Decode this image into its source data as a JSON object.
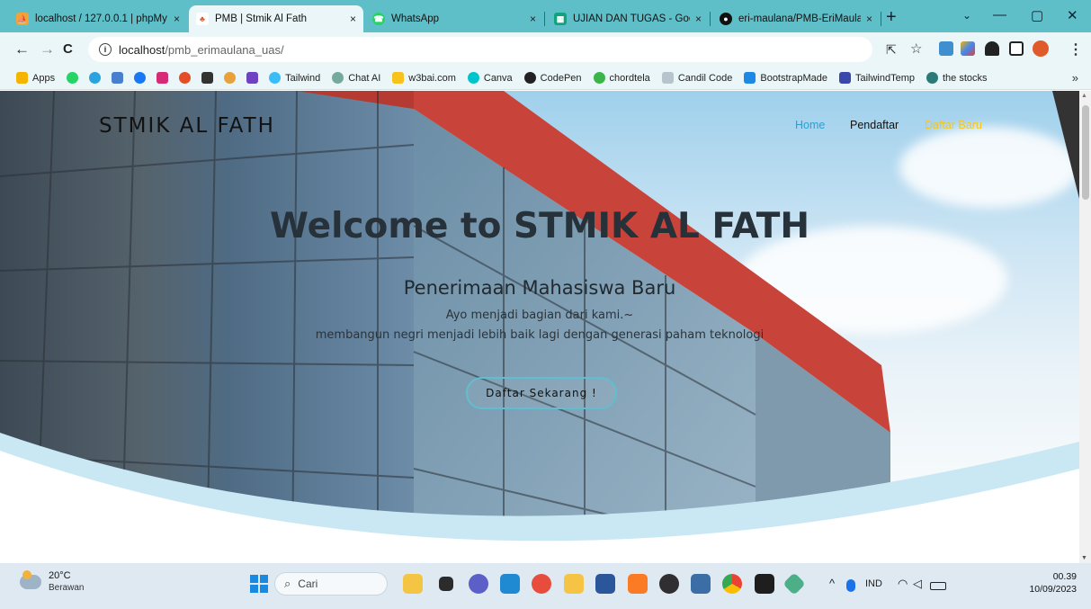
{
  "tabs": [
    {
      "title": "localhost / 127.0.0.1 | phpMy",
      "close": "×",
      "color": "#f0a33a",
      "glyph": "⛵"
    },
    {
      "title": "PMB | Stmik Al Fath",
      "close": "×",
      "color": "#ffffff",
      "glyph": "♣"
    },
    {
      "title": "WhatsApp",
      "close": "×",
      "color": "#25d366",
      "glyph": "☎"
    },
    {
      "title": "UJIAN DAN TUGAS - Google",
      "close": "×",
      "color": "#10a37f",
      "glyph": "▦"
    },
    {
      "title": "eri-maulana/PMB-EriMaulan",
      "close": "×",
      "color": "#111111",
      "glyph": "●"
    }
  ],
  "browser": {
    "new_tab": "+",
    "back": "←",
    "forward": "→",
    "reload": "C",
    "url_host": "localhost",
    "url_path": "/pmb_erimaulana_uas/",
    "info": "i",
    "share": "⇱",
    "star": "☆",
    "minimize": "—",
    "maximize": "▢",
    "close": "✕",
    "tablist": "⌄",
    "menu": "⋮"
  },
  "bookmarks": [
    {
      "label": "Apps",
      "color": "#f4b400"
    },
    {
      "label": "",
      "color": "#25d366"
    },
    {
      "label": "",
      "color": "#2aa3e0"
    },
    {
      "label": "",
      "color": "#4a7fd0"
    },
    {
      "label": "",
      "color": "#1877f2"
    },
    {
      "label": "",
      "color": "#d62976"
    },
    {
      "label": "",
      "color": "#e44d26"
    },
    {
      "label": "",
      "color": "#333333"
    },
    {
      "label": "",
      "color": "#e9a23b"
    },
    {
      "label": "",
      "color": "#6f42c1"
    },
    {
      "label": "Tailwind",
      "color": "#38bdf8"
    },
    {
      "label": "Chat AI",
      "color": "#74aa9c"
    },
    {
      "label": "w3bai.com",
      "color": "#f7c21b"
    },
    {
      "label": "Canva",
      "color": "#00c4cc"
    },
    {
      "label": "CodePen",
      "color": "#222222"
    },
    {
      "label": "chordtela",
      "color": "#3bb54a"
    },
    {
      "label": "Candil Code",
      "color": "#b8c4cc"
    },
    {
      "label": "BootstrapMade",
      "color": "#1e88e5"
    },
    {
      "label": "TailwindTemp",
      "color": "#3949ab"
    },
    {
      "label": "the stocks",
      "color": "#2b7a78"
    }
  ],
  "bookmarks_more": "»",
  "site": {
    "brand": "STMIK AL FATH",
    "nav": [
      {
        "label": "Home",
        "color": "#2a9fd6"
      },
      {
        "label": "Pendaftar",
        "color": "#111111"
      },
      {
        "label": "Daftar Baru",
        "color": "#f3c623"
      }
    ],
    "heading": "Welcome to STMIK AL FATH",
    "subheading": "Penerimaan Mahasiswa Baru",
    "tagline1": "Ayo menjadi bagian dari kami.~",
    "tagline2": "membangun negri menjadi lebih baik lagi dengan generasi paham teknologi",
    "cta": "Daftar Sekarang !",
    "accent": "#5fbfd0"
  },
  "taskbar": {
    "temp": "20°C",
    "weather": "Berawan",
    "search_placeholder": "Cari",
    "search_icon": "⌕",
    "tray_chevron": "^",
    "lang": "IND",
    "time": "00.39",
    "date": "10/09/2023",
    "apps": [
      {
        "name": "file-explorer-icon",
        "color": "#f4c542"
      },
      {
        "name": "task-view-icon",
        "color": "#2b2b2b"
      },
      {
        "name": "chat-icon",
        "color": "#5b5fc7"
      },
      {
        "name": "vscode-icon",
        "color": "#1f8ad2"
      },
      {
        "name": "chrome-icon",
        "color": "#e74c3c"
      },
      {
        "name": "folder-icon",
        "color": "#f6c445"
      },
      {
        "name": "word-icon",
        "color": "#2b579a"
      },
      {
        "name": "xampp-icon",
        "color": "#fb7a24"
      },
      {
        "name": "obs-icon",
        "color": "#302e31"
      },
      {
        "name": "virtualbox-icon",
        "color": "#3a6ea5"
      },
      {
        "name": "chrome-active-icon",
        "color": "#34a853"
      },
      {
        "name": "terminal-icon",
        "color": "#1e1e1e"
      },
      {
        "name": "git-icon",
        "color": "#4caf88"
      }
    ]
  }
}
